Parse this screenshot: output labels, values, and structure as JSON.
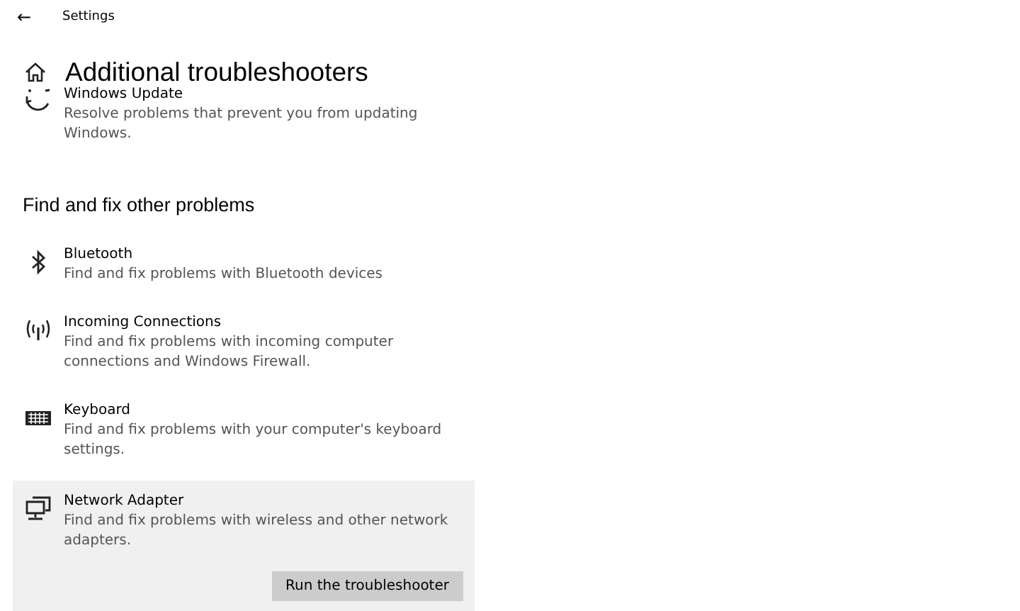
{
  "header": {
    "back": "←",
    "title": "Settings"
  },
  "page_title": "Additional troubleshooters",
  "top_item": {
    "title": "Windows Update",
    "description": "Resolve problems that prevent you from updating Windows."
  },
  "section_heading": "Find and fix other problems",
  "items": [
    {
      "title": "Bluetooth",
      "description": "Find and fix problems with Bluetooth devices",
      "selected": false
    },
    {
      "title": "Incoming Connections",
      "description": "Find and fix problems with incoming computer connections and Windows Firewall.",
      "selected": false
    },
    {
      "title": "Keyboard",
      "description": "Find and fix problems with your computer's keyboard settings.",
      "selected": false
    },
    {
      "title": "Network Adapter",
      "description": "Find and fix problems with wireless and other network adapters.",
      "selected": true,
      "action": "Run the troubleshooter"
    }
  ]
}
